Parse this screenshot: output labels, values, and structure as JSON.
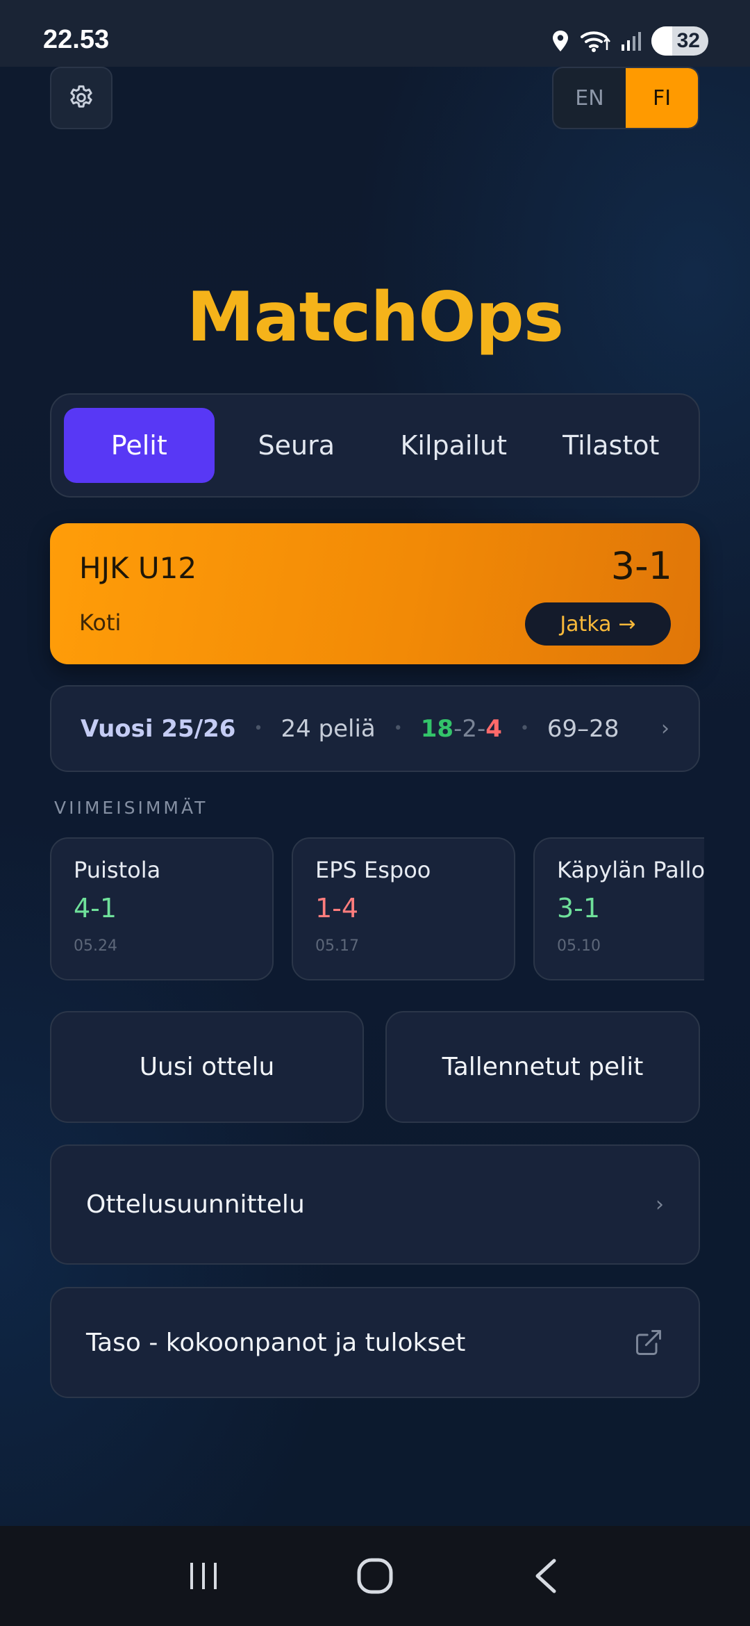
{
  "status_bar": {
    "time": "22.53",
    "battery": "32",
    "icons": [
      "location-icon",
      "wifi-icon",
      "signal-icon",
      "battery-icon"
    ]
  },
  "top": {
    "settings_icon": "gear-icon",
    "language": {
      "options": [
        "EN",
        "FI"
      ],
      "selected": "FI"
    }
  },
  "app": {
    "title": "MatchOps"
  },
  "tabs": [
    {
      "label": "Pelit",
      "active": true
    },
    {
      "label": "Seura",
      "active": false
    },
    {
      "label": "Kilpailut",
      "active": false
    },
    {
      "label": "Tilastot",
      "active": false
    }
  ],
  "current_game": {
    "team": "HJK U12",
    "score": "3-1",
    "venue": "Koti",
    "continue_label": "Jatka",
    "continue_arrow": "→"
  },
  "season": {
    "label": "Vuosi 25/26",
    "games": "24 peliä",
    "wins": "18",
    "draws": "2",
    "losses": "4",
    "sep": "-",
    "goals": "69–28",
    "chevron": "›"
  },
  "recent": {
    "heading": "VIIMEISIMMÄT",
    "games": [
      {
        "opponent": "Puistola",
        "score": "4-1",
        "result": "win",
        "date": "05.24"
      },
      {
        "opponent": "EPS Espoo",
        "score": "1-4",
        "result": "loss",
        "date": "05.17"
      },
      {
        "opponent": "Käpylän Pallo",
        "score": "3-1",
        "result": "win",
        "date": "05.10"
      }
    ]
  },
  "actions": {
    "new_game": "Uusi ottelu",
    "saved_games": "Tallennetut pelit",
    "planning": "Ottelusuunnittelu",
    "planning_chevron": "›",
    "taso": "Taso - kokoonpanot ja tulokset",
    "taso_icon": "external-link-icon"
  },
  "nav": {
    "buttons": [
      "recents-icon",
      "home-icon",
      "back-icon"
    ]
  },
  "colors": {
    "accent_orange": "#ff9a00",
    "title_gold": "#f5b31a",
    "tab_active": "#5838f5",
    "win_green": "#33c46a",
    "loss_red": "#ff6a6a",
    "background": "#0c1526"
  }
}
